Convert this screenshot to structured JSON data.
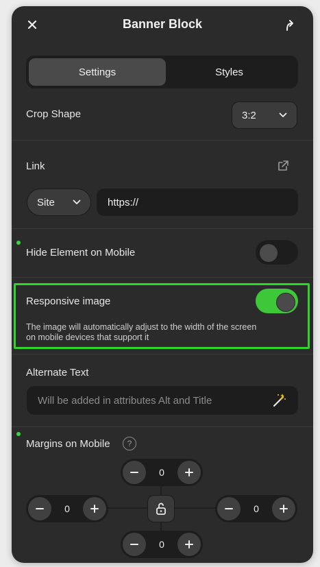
{
  "header": {
    "title": "Banner Block",
    "close_icon": "close-icon",
    "share_icon": "share-icon"
  },
  "tabs": [
    {
      "label": "Settings",
      "active": true
    },
    {
      "label": "Styles",
      "active": false
    }
  ],
  "crop_shape": {
    "label": "Crop Shape",
    "value": "3:2"
  },
  "link": {
    "label": "Link",
    "type_value": "Site",
    "url_value": "https://"
  },
  "hide_mobile": {
    "label": "Hide Element on Mobile",
    "enabled": false
  },
  "responsive": {
    "label": "Responsive image",
    "enabled": true,
    "description_line1": "The image will automatically adjust to the width of the screen",
    "description_line2": "on mobile devices that support it"
  },
  "alt_text": {
    "label": "Alternate Text",
    "placeholder": "Will be added in attributes Alt and Title"
  },
  "margins": {
    "label": "Margins on Mobile",
    "help": "?",
    "top": "0",
    "left": "0",
    "right": "0",
    "bottom": "0"
  },
  "colors": {
    "accent_green": "#3ec739",
    "highlight": "#2fd52a",
    "panel": "#2b2b2b"
  }
}
